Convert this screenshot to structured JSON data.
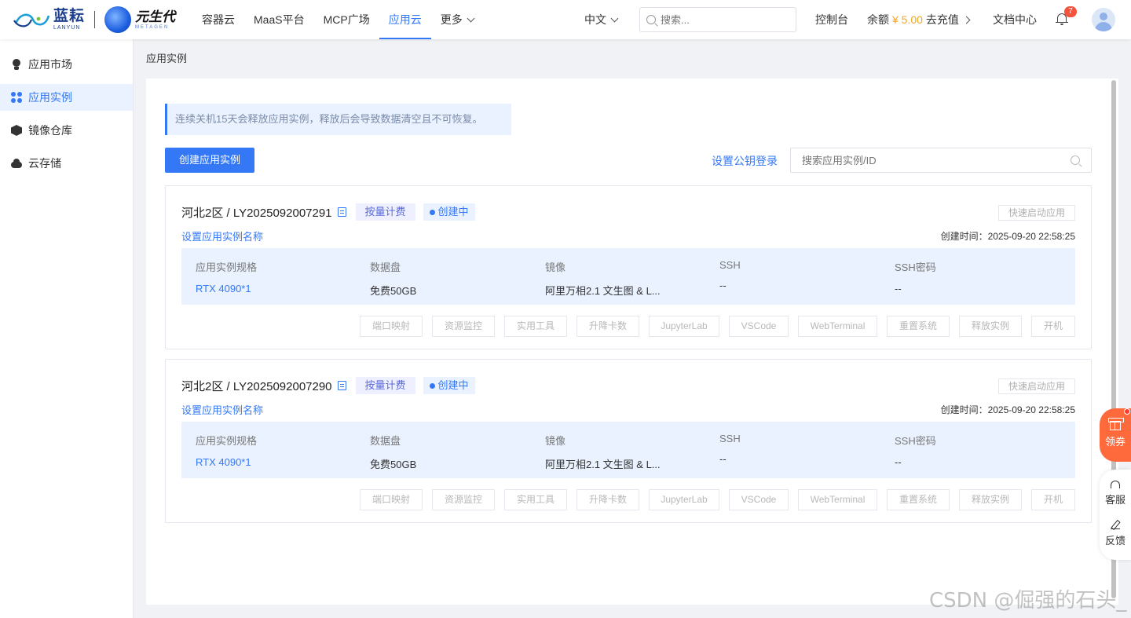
{
  "header": {
    "logo_lanyun_cn": "蓝耘",
    "logo_lanyun_en": "LANYUN",
    "logo_meta_cn": "元生代",
    "logo_meta_en": "METAGEN",
    "nav": [
      {
        "label": "容器云"
      },
      {
        "label": "MaaS平台"
      },
      {
        "label": "MCP广场"
      },
      {
        "label": "应用云",
        "active": true
      },
      {
        "label": "更多"
      }
    ],
    "language": "中文",
    "search_placeholder": "搜索...",
    "console": "控制台",
    "balance_label": "余额",
    "balance_amount": "¥ 5.00",
    "recharge": "去充值",
    "docs": "文档中心",
    "notification_count": "7"
  },
  "sidebar": {
    "items": [
      {
        "label": "应用市场",
        "icon": "bulb-icon"
      },
      {
        "label": "应用实例",
        "icon": "grid-icon",
        "active": true
      },
      {
        "label": "镜像仓库",
        "icon": "cube-icon"
      },
      {
        "label": "云存储",
        "icon": "cloud-icon"
      }
    ]
  },
  "main": {
    "breadcrumb": "应用实例",
    "notice": "连续关机15天会释放应用实例，释放后会导致数据清空且不可恢复。",
    "create_button": "创建应用实例",
    "set_key_login": "设置公钥登录",
    "search_placeholder": "搜索应用实例/ID",
    "instances": [
      {
        "title": "河北2区 / LY2025092007291",
        "billing": "按量计费",
        "status": "创建中",
        "quick_start": "快速启动应用",
        "set_name": "设置应用实例名称",
        "created": "创建时间：2025-09-20 22:58:25",
        "spec_label": "应用实例规格",
        "spec_value": "RTX 4090*1",
        "disk_label": "数据盘",
        "disk_value": "免费50GB",
        "image_label": "镜像",
        "image_value": "阿里万相2.1 文生图 & L...",
        "ssh_label": "SSH",
        "ssh_value": "--",
        "sshpwd_label": "SSH密码",
        "sshpwd_value": "--"
      },
      {
        "title": "河北2区 / LY2025092007290",
        "billing": "按量计费",
        "status": "创建中",
        "quick_start": "快速启动应用",
        "set_name": "设置应用实例名称",
        "created": "创建时间：2025-09-20 22:58:25",
        "spec_label": "应用实例规格",
        "spec_value": "RTX 4090*1",
        "disk_label": "数据盘",
        "disk_value": "免费50GB",
        "image_label": "镜像",
        "image_value": "阿里万相2.1 文生图 & L...",
        "ssh_label": "SSH",
        "ssh_value": "--",
        "sshpwd_label": "SSH密码",
        "sshpwd_value": "--"
      }
    ],
    "actions": [
      "端口映射",
      "资源监控",
      "实用工具",
      "升降卡数",
      "JupyterLab",
      "VSCode",
      "WebTerminal",
      "重置系统",
      "释放实例",
      "开机"
    ]
  },
  "float": {
    "coupon": "领券",
    "service": "客服",
    "feedback": "反馈"
  },
  "watermark": "CSDN @倔强的石头_",
  "colors": {
    "accent": "#3478f6",
    "balance": "#f5a623",
    "coupon": "#ff6a3d"
  }
}
